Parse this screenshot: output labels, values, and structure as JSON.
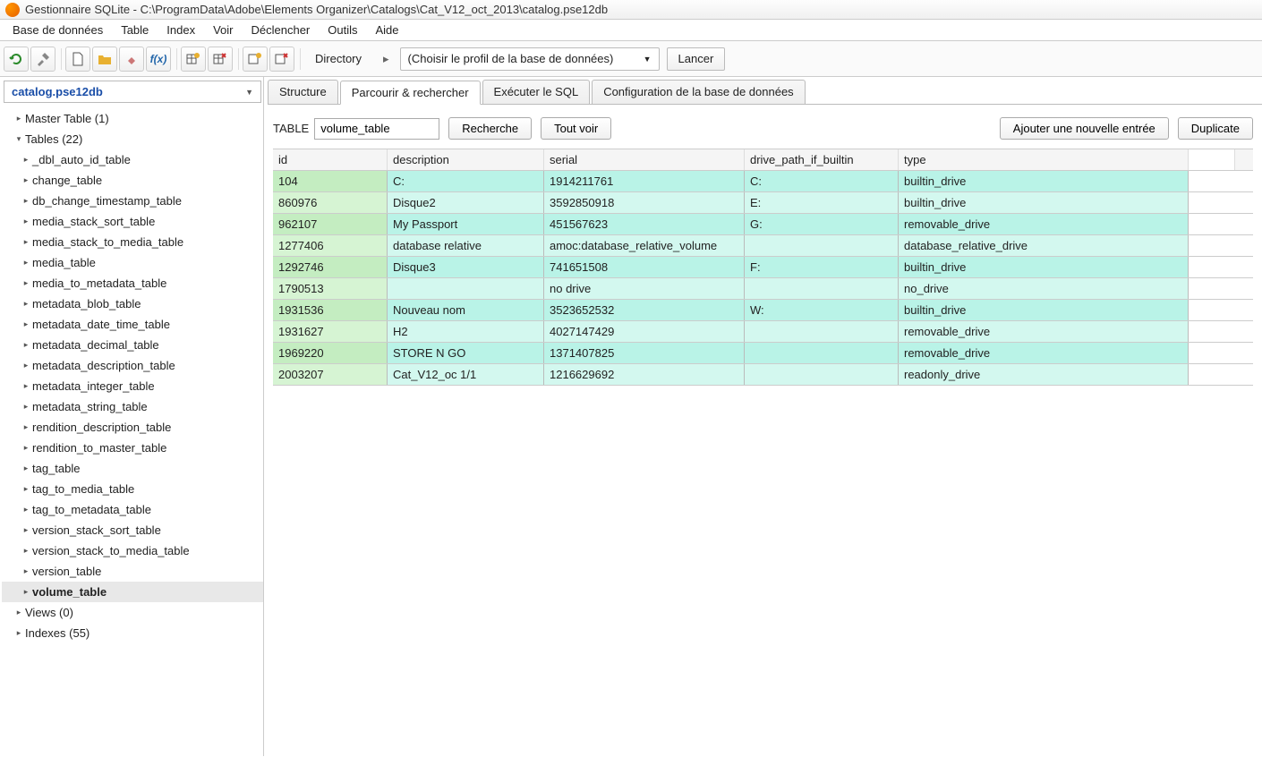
{
  "window": {
    "title": "Gestionnaire SQLite - C:\\ProgramData\\Adobe\\Elements Organizer\\Catalogs\\Cat_V12_oct_2013\\catalog.pse12db"
  },
  "menu": {
    "items": [
      "Base de données",
      "Table",
      "Index",
      "Voir",
      "Déclencher",
      "Outils",
      "Aide"
    ]
  },
  "toolbar": {
    "directory_label": "Directory",
    "profile_placeholder": "(Choisir le profil de la base de données)",
    "launch": "Lancer"
  },
  "sidebar": {
    "database": "catalog.pse12db",
    "groups": [
      {
        "label": "Master Table (1)",
        "expanded": false,
        "items": []
      },
      {
        "label": "Tables (22)",
        "expanded": true,
        "items": [
          "_dbl_auto_id_table",
          "change_table",
          "db_change_timestamp_table",
          "media_stack_sort_table",
          "media_stack_to_media_table",
          "media_table",
          "media_to_metadata_table",
          "metadata_blob_table",
          "metadata_date_time_table",
          "metadata_decimal_table",
          "metadata_description_table",
          "metadata_integer_table",
          "metadata_string_table",
          "rendition_description_table",
          "rendition_to_master_table",
          "tag_table",
          "tag_to_media_table",
          "tag_to_metadata_table",
          "version_stack_sort_table",
          "version_stack_to_media_table",
          "version_table",
          "volume_table"
        ],
        "selected": "volume_table"
      },
      {
        "label": "Views (0)",
        "expanded": false,
        "items": []
      },
      {
        "label": "Indexes (55)",
        "expanded": false,
        "items": []
      }
    ]
  },
  "tabs": {
    "items": [
      "Structure",
      "Parcourir & rechercher",
      "Exécuter le SQL",
      "Configuration de la base de données"
    ],
    "active": 1
  },
  "browse": {
    "table_label": "TABLE",
    "table_name": "volume_table",
    "search_btn": "Recherche",
    "showall_btn": "Tout voir",
    "add_btn": "Ajouter une nouvelle entrée",
    "dup_btn": "Duplicate",
    "columns": [
      "id",
      "description",
      "serial",
      "drive_path_if_builtin",
      "type"
    ],
    "rows": [
      {
        "id": "104",
        "description": "C:",
        "serial": "1914211761",
        "drive": "C:",
        "type": "builtin_drive"
      },
      {
        "id": "860976",
        "description": "Disque2",
        "serial": "3592850918",
        "drive": "E:",
        "type": "builtin_drive"
      },
      {
        "id": "962107",
        "description": "My Passport",
        "serial": "451567623",
        "drive": "G:",
        "type": "removable_drive"
      },
      {
        "id": "1277406",
        "description": "database relative",
        "serial": "amoc:database_relative_volume",
        "drive": "",
        "type": "database_relative_drive"
      },
      {
        "id": "1292746",
        "description": "Disque3",
        "serial": "741651508",
        "drive": "F:",
        "type": "builtin_drive"
      },
      {
        "id": "1790513",
        "description": "",
        "serial": "no drive",
        "drive": "",
        "type": "no_drive"
      },
      {
        "id": "1931536",
        "description": "Nouveau nom",
        "serial": "3523652532",
        "drive": "W:",
        "type": "builtin_drive"
      },
      {
        "id": "1931627",
        "description": "H2",
        "serial": "4027147429",
        "drive": "",
        "type": "removable_drive"
      },
      {
        "id": "1969220",
        "description": "STORE N GO",
        "serial": "1371407825",
        "drive": "",
        "type": "removable_drive"
      },
      {
        "id": "2003207",
        "description": "Cat_V12_oc 1/1",
        "serial": "1216629692",
        "drive": "",
        "type": "readonly_drive"
      }
    ]
  }
}
